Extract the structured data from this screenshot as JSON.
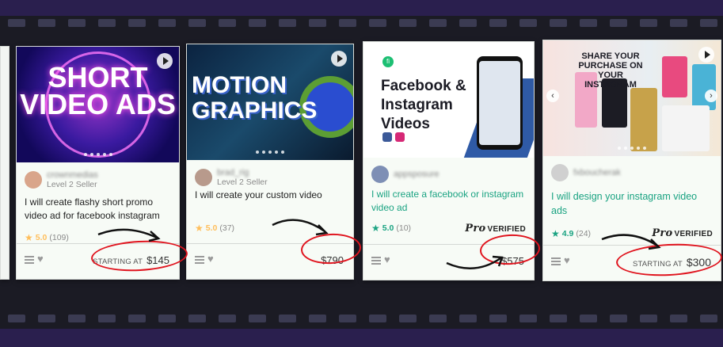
{
  "colors": {
    "background": "#2a1f4e",
    "film": "#1b1b24",
    "accent_green": "#1aa382",
    "star_yellow": "#ffbe5b",
    "annotation_red": "#e0141e"
  },
  "cards": [
    {
      "thumb_title": "SHORT VIDEO ADS",
      "seller_name": "crownmedias",
      "seller_level": "Level 2 Seller",
      "title": "I will create flashy short promo video ad for facebook instagram",
      "rating": "5.0",
      "rating_count": "(109)",
      "starting_label": "STARTING AT",
      "price": "$145"
    },
    {
      "thumb_title": "MOTION GRAPHICS",
      "seller_name": "brad_rig",
      "seller_level": "Level 2 Seller",
      "title": "I will create your custom video",
      "rating": "5.0",
      "rating_count": "(37)",
      "price": "$790"
    },
    {
      "thumb_title": "Facebook & Instagram Videos",
      "logo_letter": "fi",
      "seller_name": "appsposure",
      "title": "I will create a facebook or instagram video ad",
      "rating": "5.0",
      "rating_count": "(10)",
      "pro_badge": "Pro",
      "pro_verified": "VERIFIED",
      "price": "$575"
    },
    {
      "thumb_title": "SHARE YOUR PURCHASE ON YOUR INSTAGRAM",
      "seller_name": "fxboucherak",
      "title": "I will design your instagram video ads",
      "rating": "4.9",
      "rating_count": "(24)",
      "pro_badge": "Pro",
      "pro_verified": "VERIFIED",
      "starting_label": "STARTING AT",
      "price": "$300"
    }
  ],
  "icons": {
    "play": "play-icon",
    "menu": "list-icon",
    "heart": "heart-icon",
    "star": "star-icon",
    "prev": "chevron-left-icon",
    "next": "chevron-right-icon"
  }
}
